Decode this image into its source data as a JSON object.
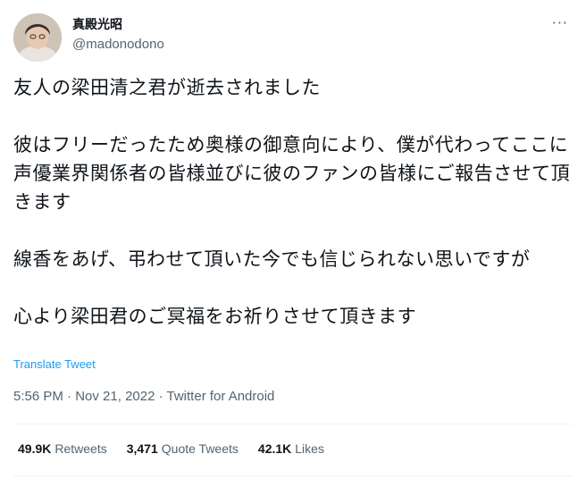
{
  "author": {
    "display_name": "真殿光昭",
    "handle": "@madonodono"
  },
  "more_icon": "more-horizontal-icon",
  "more_glyph": "···",
  "tweet_text": "友人の梁田清之君が逝去されました\n\n彼はフリーだったため奥様の御意向により、僕が代わってここに声優業界関係者の皆様並びに彼のファンの皆様にご報告させて頂きます\n\n線香をあげ、弔わせて頂いた今でも信じられない思いですが\n\n心より梁田君のご冥福をお祈りさせて頂きます",
  "translate_label": "Translate Tweet",
  "meta": {
    "time": "5:56 PM",
    "date": "Nov 21, 2022",
    "source": "Twitter for Android",
    "separator": " · "
  },
  "stats": {
    "retweets_count": "49.9K",
    "retweets_label": "Retweets",
    "quotes_count": "3,471",
    "quotes_label": "Quote Tweets",
    "likes_count": "42.1K",
    "likes_label": "Likes"
  },
  "colors": {
    "text": "#0f1419",
    "secondary": "#536471",
    "link": "#1d9bf0",
    "divider": "#eff3f4"
  }
}
